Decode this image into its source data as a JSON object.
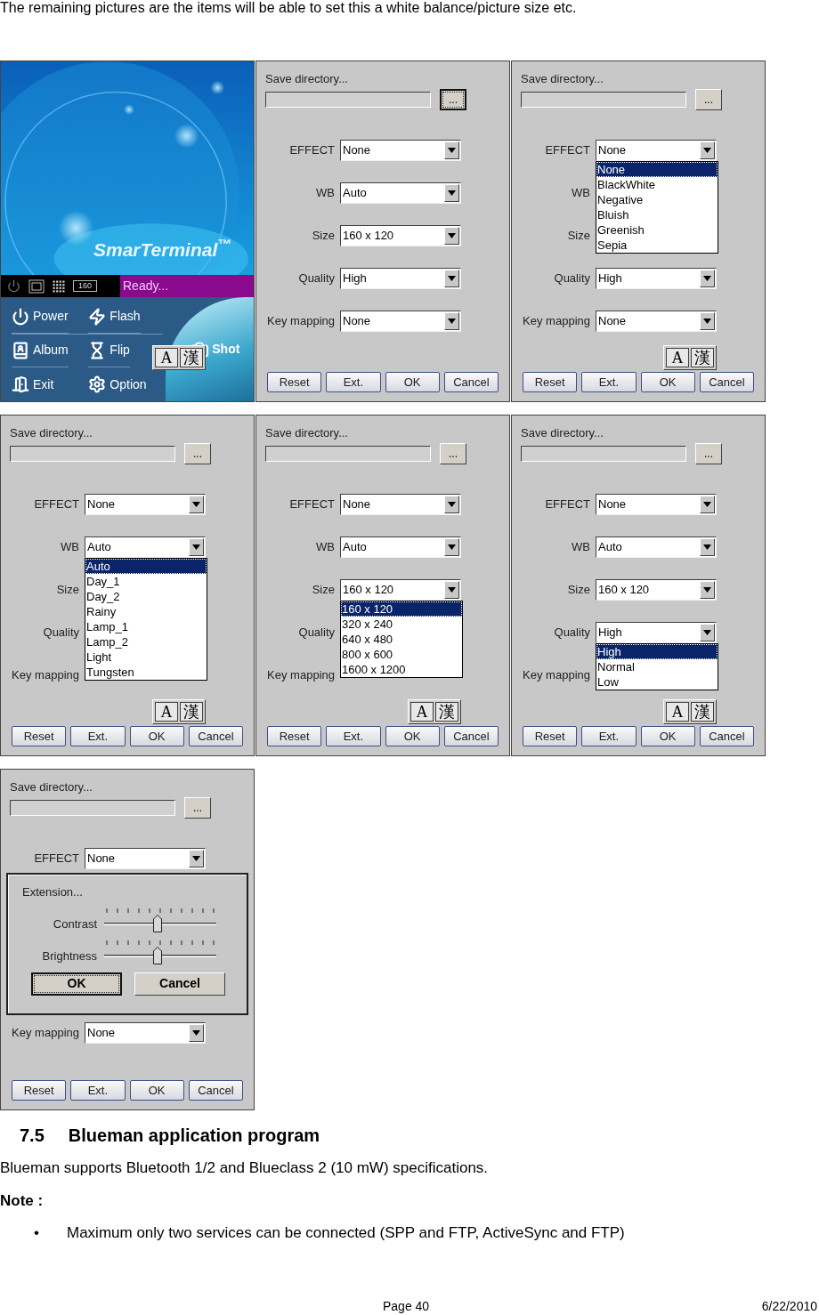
{
  "intro": "The remaining pictures are the items will be able to set this a white balance/picture size etc.",
  "screens": [
    {
      "kind": "camera_home",
      "logo": "SmarTerminal$^{™}$",
      "status_badge": "160",
      "status": "Ready...",
      "menu": [
        {
          "kind": "power",
          "label": "Power"
        },
        {
          "kind": "flash",
          "label": "Flash"
        },
        {
          "kind": "album",
          "label": "Album"
        },
        {
          "kind": "flip",
          "label": "Flip"
        },
        {
          "kind": "exit",
          "label": "Exit"
        },
        {
          "kind": "option",
          "label": "Option"
        }
      ],
      "shot": "Shot",
      "ime": [
        "A",
        "漢"
      ]
    },
    {
      "kind": "settings",
      "save_directory": "Save directory...",
      "browse": "...",
      "browse_focused": true,
      "fields": [
        {
          "label": "EFFECT",
          "value": "None"
        },
        {
          "label": "WB",
          "value": "Auto"
        },
        {
          "label": "Size",
          "value": "160 x 120"
        },
        {
          "label": "Quality",
          "value": "High"
        },
        {
          "label": "Key mapping",
          "value": "None"
        }
      ],
      "buttons": [
        "Reset",
        "Ext.",
        "OK",
        "Cancel"
      ]
    },
    {
      "kind": "settings",
      "save_directory": "Save directory...",
      "browse": "...",
      "browse_focused": false,
      "fields": [
        {
          "label": "EFFECT",
          "value": "None",
          "options": [
            {
              "label": "None",
              "selected": true
            },
            {
              "label": "BlackWhite",
              "selected": false
            },
            {
              "label": "Negative",
              "selected": false
            },
            {
              "label": "Bluish",
              "selected": false
            },
            {
              "label": "Greenish",
              "selected": false
            },
            {
              "label": "Sepia",
              "selected": false
            }
          ]
        },
        {
          "label": "WB"
        },
        {
          "label": "Size"
        },
        {
          "label": "Quality",
          "value": "High"
        },
        {
          "label": "Key mapping",
          "value": "None"
        }
      ],
      "ime": [
        "A",
        "漢"
      ],
      "buttons": [
        "Reset",
        "Ext.",
        "OK",
        "Cancel"
      ]
    },
    {
      "kind": "settings",
      "save_directory": "Save directory...",
      "browse": "...",
      "browse_focused": false,
      "fields": [
        {
          "label": "EFFECT",
          "value": "None"
        },
        {
          "label": "WB",
          "value": "Auto",
          "options": [
            {
              "label": "Auto",
              "selected": true
            },
            {
              "label": "Day_1",
              "selected": false
            },
            {
              "label": "Day_2",
              "selected": false
            },
            {
              "label": "Rainy",
              "selected": false
            },
            {
              "label": "Lamp_1",
              "selected": false
            },
            {
              "label": "Lamp_2",
              "selected": false
            },
            {
              "label": "Light",
              "selected": false
            },
            {
              "label": "Tungsten",
              "selected": false
            }
          ]
        },
        {
          "label": "Size"
        },
        {
          "label": "Quality"
        },
        {
          "label": "Key mapping"
        }
      ],
      "ime": [
        "A",
        "漢"
      ],
      "buttons": [
        "Reset",
        "Ext.",
        "OK",
        "Cancel"
      ]
    },
    {
      "kind": "settings",
      "save_directory": "Save directory...",
      "browse": "...",
      "browse_focused": false,
      "fields": [
        {
          "label": "EFFECT",
          "value": "None"
        },
        {
          "label": "WB",
          "value": "Auto"
        },
        {
          "label": "Size",
          "value": "160 x 120",
          "options": [
            {
              "label": "160 x 120",
              "selected": true
            },
            {
              "label": "320 x 240",
              "selected": false
            },
            {
              "label": "640 x 480",
              "selected": false
            },
            {
              "label": "800 x 600",
              "selected": false
            },
            {
              "label": "1600 x 1200",
              "selected": false
            }
          ]
        },
        {
          "label": "Quality"
        },
        {
          "label": "Key mapping"
        }
      ],
      "ime": [
        "A",
        "漢"
      ],
      "buttons": [
        "Reset",
        "Ext.",
        "OK",
        "Cancel"
      ]
    },
    {
      "kind": "settings",
      "save_directory": "Save directory...",
      "browse": "...",
      "browse_focused": false,
      "fields": [
        {
          "label": "EFFECT",
          "value": "None"
        },
        {
          "label": "WB",
          "value": "Auto"
        },
        {
          "label": "Size",
          "value": "160 x 120"
        },
        {
          "label": "Quality",
          "value": "High",
          "options": [
            {
              "label": "High",
              "selected": true
            },
            {
              "label": "Normal",
              "selected": false
            },
            {
              "label": "Low",
              "selected": false
            }
          ]
        },
        {
          "label": "Key mapping"
        }
      ],
      "ime": [
        "A",
        "漢"
      ],
      "buttons": [
        "Reset",
        "Ext.",
        "OK",
        "Cancel"
      ]
    },
    {
      "kind": "settings",
      "save_directory": "Save directory...",
      "browse": "...",
      "browse_focused": false,
      "fields": [
        {
          "label": "EFFECT",
          "value": "None"
        },
        {
          "label": "Key mapping",
          "value": "None"
        }
      ],
      "dialog": {
        "title": "Extension...",
        "sliders": [
          {
            "label": "Contrast",
            "level": 0.48
          },
          {
            "label": "Brightness",
            "level": 0.48
          }
        ],
        "buttons": [
          {
            "label": "OK",
            "focused": true
          },
          {
            "label": "Cancel",
            "focused": false
          }
        ]
      },
      "buttons": [
        "Reset",
        "Ext.",
        "OK",
        "Cancel"
      ]
    }
  ],
  "section": {
    "number": "7.5",
    "title": "Blueman application program"
  },
  "paragraph": "Blueman supports Bluetooth 1/2 and Blueclass 2 (10 mW) specifications.",
  "note_label": "Note :",
  "bullets": [
    {
      "marker": "•",
      "text": "Maximum only two services can be connected (SPP and FTP, ActiveSync and FTP)"
    }
  ],
  "footer": {
    "page": "Page 40",
    "date": "6/22/2010"
  }
}
